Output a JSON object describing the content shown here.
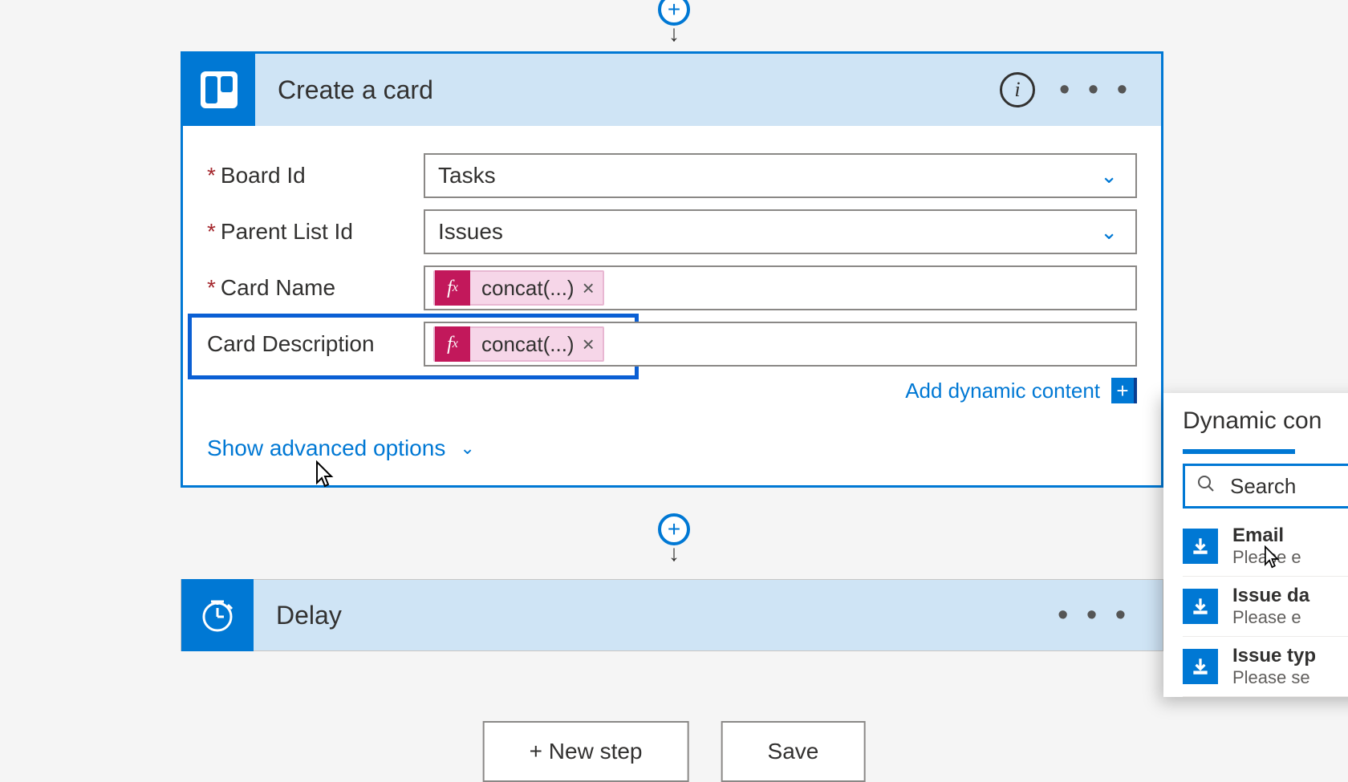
{
  "create_card": {
    "title": "Create a card",
    "info_glyph": "i",
    "board_id": {
      "required": "*",
      "label": "Board Id",
      "value": "Tasks"
    },
    "parent_list": {
      "required": "*",
      "label": "Parent List Id",
      "value": "Issues"
    },
    "card_name": {
      "required": "*",
      "label": "Card Name",
      "token": "concat(...)"
    },
    "card_desc": {
      "label": "Card Description",
      "token": "concat(...)"
    },
    "add_dynamic": "Add dynamic content",
    "advanced": "Show advanced options"
  },
  "delay": {
    "title": "Delay"
  },
  "buttons": {
    "new_step": "+  New step",
    "save": "Save"
  },
  "dyn": {
    "title": "Dynamic con",
    "search_placeholder": "Search",
    "items": [
      {
        "name": "Email",
        "sub": "Please e"
      },
      {
        "name": "Issue da",
        "sub": "Please e"
      },
      {
        "name": "Issue typ",
        "sub": "Please se"
      }
    ]
  },
  "glyphs": {
    "token_close": "×",
    "plus": "+"
  }
}
